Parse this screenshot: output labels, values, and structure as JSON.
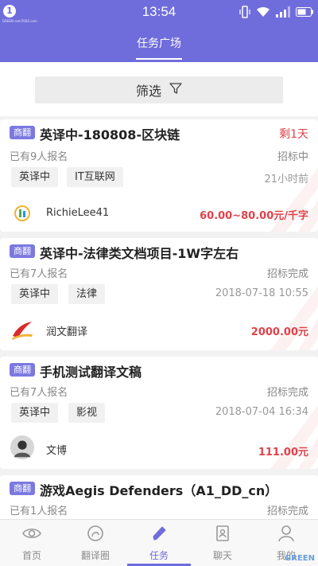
{
  "status_bar": {
    "badge": "1",
    "watermark": "GREEN com7002.com",
    "time": "13:54"
  },
  "nav": {
    "title": "任务广场"
  },
  "filter": {
    "label": "筛选"
  },
  "tasks": [
    {
      "type_badge": "商翻",
      "title": "英译中-180808-区块链",
      "deadline": "剩1天",
      "signups": "已有9人报名",
      "status": "招标中",
      "tags": [
        "英译中",
        "IT互联网"
      ],
      "date": "21小时前",
      "publisher": "RichieLee41",
      "avatar_icon": "colorful-logo-icon",
      "price": "60.00~80.00元/千字"
    },
    {
      "type_badge": "商翻",
      "title": "英译中-法律类文档项目-1W字左右",
      "deadline": "",
      "signups": "已有7人报名",
      "status": "招标完成",
      "tags": [
        "英译中",
        "法律"
      ],
      "date": "2018-07-18 10:55",
      "publisher": "润文翻译",
      "avatar_icon": "red-brush-logo-icon",
      "price": "2000.00元"
    },
    {
      "type_badge": "商翻",
      "title": "手机测试翻译文稿",
      "deadline": "",
      "signups": "已有7人报名",
      "status": "招标完成",
      "tags": [
        "英译中",
        "影视"
      ],
      "date": "2018-07-04 16:34",
      "publisher": "文博",
      "avatar_icon": "user-photo-avatar-icon",
      "price": "111.00元"
    },
    {
      "type_badge": "商翻",
      "title": "游戏Aegis Defenders（A1_DD_cn）",
      "deadline": "",
      "signups": "已有1人报名",
      "status": "招标完成"
    }
  ],
  "tabbar": {
    "items": [
      {
        "label": "首页",
        "icon": "eye-icon"
      },
      {
        "label": "翻译圈",
        "icon": "circle-icon"
      },
      {
        "label": "任务",
        "icon": "pen-icon",
        "active": true
      },
      {
        "label": "聊天",
        "icon": "chat-icon"
      },
      {
        "label": "我的",
        "icon": "user-icon"
      }
    ],
    "watermark": "GREEN"
  },
  "colors": {
    "primary": "#6f6ddc",
    "price": "#e0424a"
  }
}
